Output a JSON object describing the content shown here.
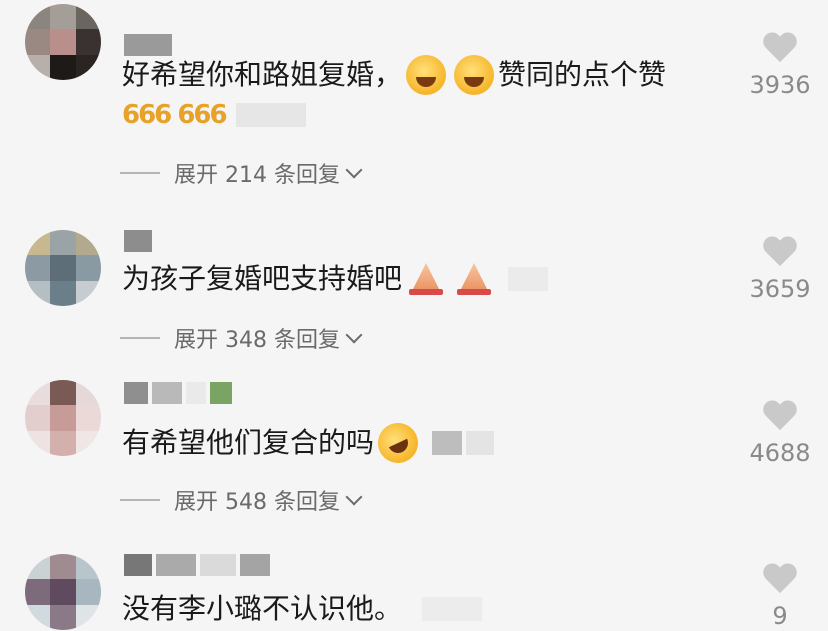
{
  "comments": [
    {
      "text": "好希望你和路姐复婚，",
      "text_after": "赞同的点个赞",
      "sixes": "666 666",
      "expand": "展开 214 条回复",
      "likes": "3936"
    },
    {
      "text": "为孩子复婚吧支持婚吧",
      "expand": "展开 348 条回复",
      "likes": "3659"
    },
    {
      "text": "有希望他们复合的吗",
      "expand": "展开 548 条回复",
      "likes": "4688"
    },
    {
      "text": "没有李小璐不认识他。",
      "likes": "9"
    }
  ],
  "icons": {
    "like": "heart-icon",
    "expand": "chevron-down-icon",
    "emoji_laugh": "laughing-face-icon",
    "emoji_pray": "folded-hands-icon",
    "emoji_rofl": "rofl-face-icon"
  },
  "colors": {
    "background": "#f5f5f5",
    "text": "#1a1a1a",
    "secondary": "#6a6a6a",
    "like_icon": "#c9c9c9",
    "six_gold": "#e7a22a"
  }
}
